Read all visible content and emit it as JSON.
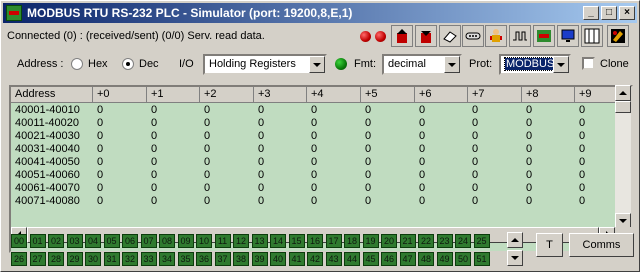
{
  "window": {
    "title": "MODBUS RTU RS-232 PLC - Simulator (port:  19200,8,E,1)"
  },
  "titlebar_buttons": {
    "minimize": "_",
    "maximize": "□",
    "close": "×"
  },
  "status": {
    "text": "Connected (0) : (received/sent) (0/0) Serv. read data."
  },
  "toolbar": {
    "icons": [
      "record-icon",
      "stop-icon",
      "upload-icon",
      "download-icon",
      "eraser-icon",
      "serial-port-icon",
      "person-icon",
      "waveform-icon",
      "tool-icon",
      "monitor-icon",
      "columns-icon",
      "settings-icon"
    ]
  },
  "controls": {
    "address_label": "Address :",
    "hex_label": "Hex",
    "dec_label": "Dec",
    "address_mode": "Dec",
    "io_label": "I/O",
    "io_value": "Holding Registers",
    "fmt_label": "Fmt:",
    "fmt_value": "decimal",
    "prot_label": "Prot:",
    "prot_value": "MODBUS",
    "clone_label": "Clone",
    "clone_checked": false
  },
  "grid": {
    "headers": [
      "Address",
      "+0",
      "+1",
      "+2",
      "+3",
      "+4",
      "+5",
      "+6",
      "+7",
      "+8",
      "+9"
    ],
    "rows": [
      {
        "address": "40001-40010",
        "values": [
          "0",
          "0",
          "0",
          "0",
          "0",
          "0",
          "0",
          "0",
          "0",
          "0"
        ]
      },
      {
        "address": "40011-40020",
        "values": [
          "0",
          "0",
          "0",
          "0",
          "0",
          "0",
          "0",
          "0",
          "0",
          "0"
        ]
      },
      {
        "address": "40021-40030",
        "values": [
          "0",
          "0",
          "0",
          "0",
          "0",
          "0",
          "0",
          "0",
          "0",
          "0"
        ]
      },
      {
        "address": "40031-40040",
        "values": [
          "0",
          "0",
          "0",
          "0",
          "0",
          "0",
          "0",
          "0",
          "0",
          "0"
        ]
      },
      {
        "address": "40041-40050",
        "values": [
          "0",
          "0",
          "0",
          "0",
          "0",
          "0",
          "0",
          "0",
          "0",
          "0"
        ]
      },
      {
        "address": "40051-40060",
        "values": [
          "0",
          "0",
          "0",
          "0",
          "0",
          "0",
          "0",
          "0",
          "0",
          "0"
        ]
      },
      {
        "address": "40061-40070",
        "values": [
          "0",
          "0",
          "0",
          "0",
          "0",
          "0",
          "0",
          "0",
          "0",
          "0"
        ]
      },
      {
        "address": "40071-40080",
        "values": [
          "0",
          "0",
          "0",
          "0",
          "0",
          "0",
          "0",
          "0",
          "0",
          "0"
        ]
      }
    ]
  },
  "coils": {
    "row1": [
      "00",
      "01",
      "02",
      "03",
      "04",
      "05",
      "06",
      "07",
      "08",
      "09",
      "10",
      "11",
      "12",
      "13",
      "14",
      "15",
      "16",
      "17",
      "18",
      "19",
      "20",
      "21",
      "22",
      "23",
      "24",
      "25"
    ],
    "row2": [
      "26",
      "27",
      "28",
      "29",
      "30",
      "31",
      "32",
      "33",
      "34",
      "35",
      "36",
      "37",
      "38",
      "39",
      "40",
      "41",
      "42",
      "43",
      "44",
      "45",
      "46",
      "47",
      "48",
      "49",
      "50",
      "51"
    ]
  },
  "buttons": {
    "t_label": "T",
    "comms_label": "Comms"
  },
  "colors": {
    "grid_bg": "#c0dcc0",
    "coil_bg": "#2f7a2f",
    "title_start": "#0a246a",
    "title_end": "#a6caf0"
  }
}
